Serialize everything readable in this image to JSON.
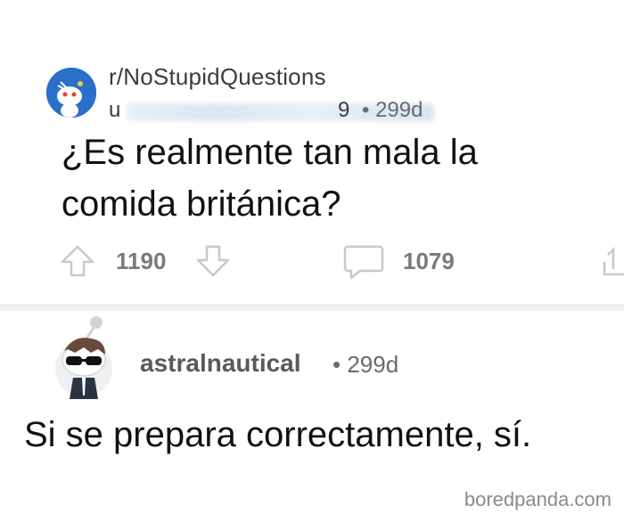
{
  "post": {
    "subreddit": "r/NoStupidQuestions",
    "author_prefix": "u",
    "author_suffix": "9",
    "meta": "• 299d",
    "title_line1": "¿Es realmente tan mala la",
    "title_line2": "comida británica?",
    "upvotes": "1190",
    "comments": "1079"
  },
  "comment": {
    "author": "astralnautical",
    "meta": "• 299d",
    "body": "Si se prepara correctamente, sí."
  },
  "watermark": "boredpanda.com",
  "colors": {
    "accent": "#2a6fc9",
    "divider": "#eef1f3",
    "icon": "#c6c8cc"
  },
  "icons": [
    "subreddit-avatar-icon",
    "upvote-icon",
    "downvote-icon",
    "comment-icon",
    "share-icon",
    "user-avatar-icon"
  ]
}
